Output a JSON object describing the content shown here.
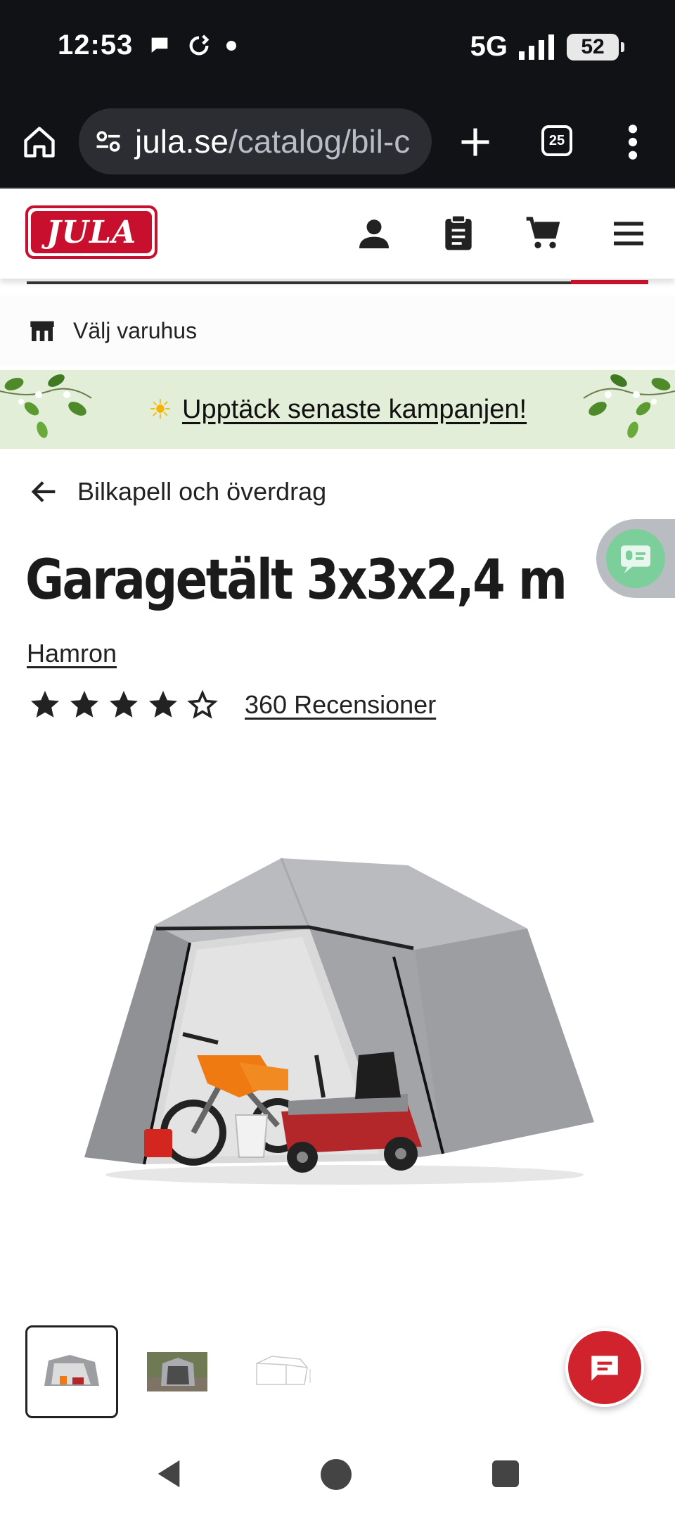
{
  "status_bar": {
    "time": "12:53",
    "network": "5G",
    "battery": "52",
    "icons": [
      "chat-bubble-icon",
      "sync-icon",
      "dot-icon",
      "signal-icon",
      "battery-icon"
    ]
  },
  "browser": {
    "url_domain": "jula.se",
    "url_path": "/catalog/bil-c",
    "tab_count": "25"
  },
  "site": {
    "logo_text": "JULA",
    "brand_color": "#c8102e",
    "header_icons": [
      "account-icon",
      "shopping-list-icon",
      "cart-icon",
      "menu-icon"
    ]
  },
  "store": {
    "label": "Välj varuhus"
  },
  "campaign": {
    "sun": "☀",
    "link_text": "Upptäck senaste kampanjen!"
  },
  "breadcrumb": {
    "label": "Bilkapell och överdrag"
  },
  "product": {
    "title": "Garagetält 3x3x2,4 m",
    "brand": "Hamron",
    "rating_stars": 4,
    "rating_max": 5,
    "reviews": "360 Recensioner"
  },
  "thumbnails": [
    "thumbnail-1",
    "thumbnail-2",
    "thumbnail-3"
  ],
  "active_thumbnail": 0
}
